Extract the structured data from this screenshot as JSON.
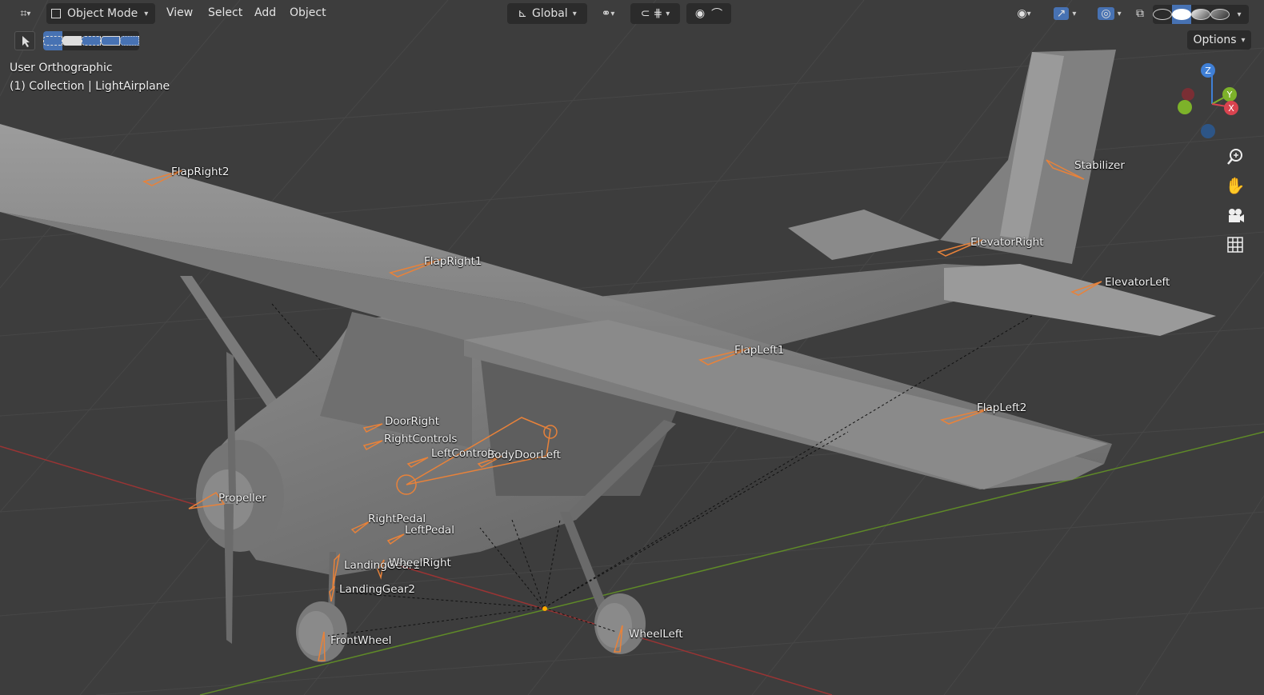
{
  "header": {
    "editor_icon": "transform-gizmo-icon",
    "mode_label": "Object Mode",
    "menus": [
      "View",
      "Select",
      "Add",
      "Object"
    ],
    "orientation_label": "Global",
    "options_label": "Options"
  },
  "viewport": {
    "view_name": "User Orthographic",
    "collection_info": "(1) Collection | LightAirplane",
    "accent_color": "#e8823a",
    "grid_x_color": "#b33b3b",
    "grid_y_color": "#6a9a2c"
  },
  "gizmo": {
    "z": "Z",
    "y": "Y",
    "x": "X"
  },
  "bones": [
    {
      "name": "FlapRight2"
    },
    {
      "name": "FlapRight1"
    },
    {
      "name": "Stabilizer"
    },
    {
      "name": "ElevatorRight"
    },
    {
      "name": "ElevatorLeft"
    },
    {
      "name": "FlapLeft1"
    },
    {
      "name": "FlapLeft2"
    },
    {
      "name": "DoorRight"
    },
    {
      "name": "RightControls"
    },
    {
      "name": "LeftControls"
    },
    {
      "name": "BodyDoorLeft"
    },
    {
      "name": "Propeller"
    },
    {
      "name": "RightPedal"
    },
    {
      "name": "LeftPedal"
    },
    {
      "name": "LandingGear1"
    },
    {
      "name": "WheelRight"
    },
    {
      "name": "LandingGear2"
    },
    {
      "name": "FrontWheel"
    },
    {
      "name": "WheelLeft"
    }
  ]
}
